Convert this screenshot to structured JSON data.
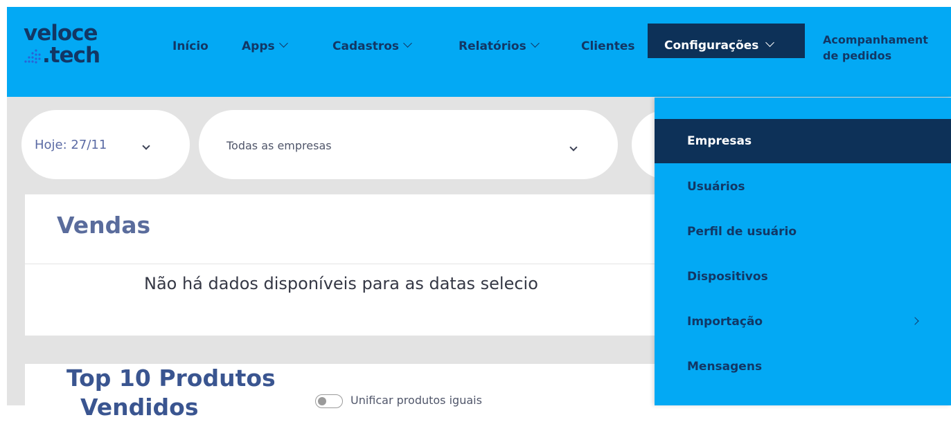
{
  "logo": {
    "line1": "veloce",
    "line2": ".tech"
  },
  "nav": {
    "inicio": "Início",
    "apps": "Apps",
    "cadastros": "Cadastros",
    "relatorios": "Relatórios",
    "clientes": "Clientes",
    "configuracoes": "Configurações",
    "acompanhamento_line1": "Acompanhament",
    "acompanhamento_line2": "de pedidos"
  },
  "filters": {
    "date": "Hoje: 27/11",
    "company": "Todas as empresas"
  },
  "vendas": {
    "title": "Vendas",
    "empty_message": "Não há dados disponíveis para as datas selecio"
  },
  "top_produtos": {
    "title_line1": "Top 10 Produtos",
    "title_line2": "Vendidos",
    "toggle_label": "Unificar produtos iguais"
  },
  "config_menu": {
    "items": [
      {
        "label": "Empresas",
        "active": true
      },
      {
        "label": "Usuários"
      },
      {
        "label": "Perfil de usuário"
      },
      {
        "label": "Dispositivos"
      },
      {
        "label": "Importação",
        "has_submenu": true
      },
      {
        "label": "Mensagens"
      }
    ]
  },
  "colors": {
    "header_bg": "#03a9f4",
    "active_bg": "#0d3158",
    "nav_text": "#123765",
    "page_bg": "#e3e3e3"
  }
}
